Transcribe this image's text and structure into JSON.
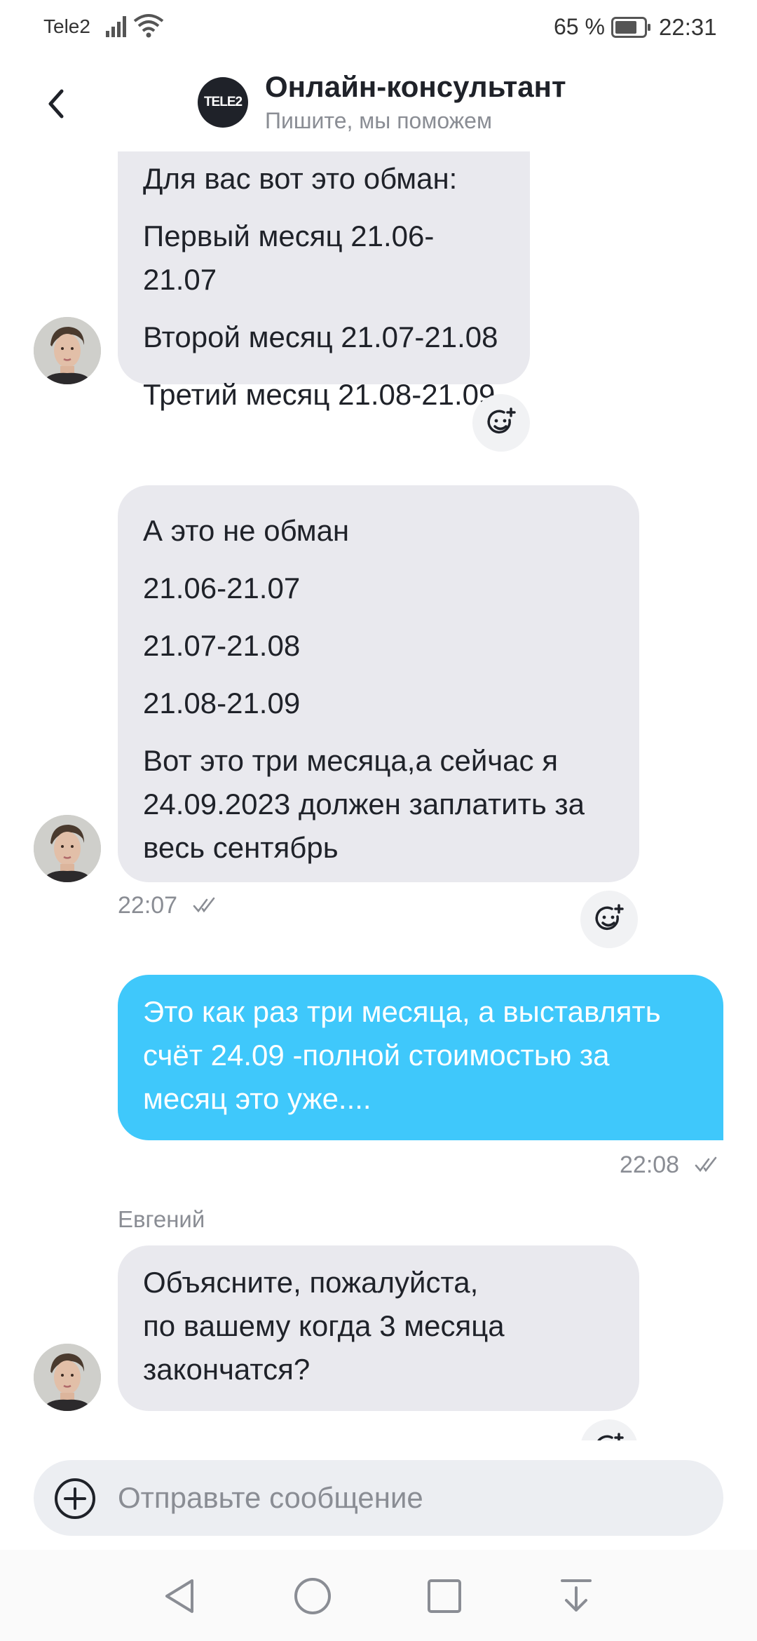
{
  "status": {
    "carrier": "Tele2",
    "battery": "65 %",
    "time": "22:31"
  },
  "header": {
    "logo_text": "TELE2",
    "title": "Онлайн-консультант",
    "subtitle": "Пишите, мы поможем"
  },
  "messages": [
    {
      "direction": "incoming",
      "lines": [
        "Для вас вот это обман:",
        "Первый месяц 21.06-21.07",
        "Второй месяц 21.07-21.08",
        "Третий месяц 21.08-21.09"
      ]
    },
    {
      "direction": "incoming",
      "lines": [
        "А это не обман",
        "21.06-21.07",
        "21.07-21.08",
        "21.08-21.09",
        "Вот это три месяца,а сейчас я",
        "24.09.2023 должен заплатить за",
        "весь сентябрь"
      ],
      "time": "22:07"
    },
    {
      "direction": "outgoing",
      "lines": [
        "Это как раз три месяца, а выставлять",
        "счёт 24.09 -полной стоимостью за",
        "месяц это уже...."
      ],
      "time": "22:08"
    },
    {
      "direction": "incoming",
      "sender": "Евгений",
      "lines": [
        "Объясните, пожалуйста,",
        "по вашему когда 3 месяца",
        "закончатся?"
      ]
    }
  ],
  "input": {
    "placeholder": "Отправьте сообщение"
  },
  "colors": {
    "incoming_bubble": "#e9e9ee",
    "outgoing_bubble": "#3fc8fb",
    "text": "#1f2229",
    "muted": "#8a8d94"
  },
  "icons": {
    "back": "chevron-left-icon",
    "react": "smiley-plus-icon",
    "check": "check-icon",
    "attach": "plus-circle-icon",
    "nav": [
      "back-triangle-icon",
      "home-circle-icon",
      "recents-square-icon",
      "notifications-down-icon"
    ]
  }
}
